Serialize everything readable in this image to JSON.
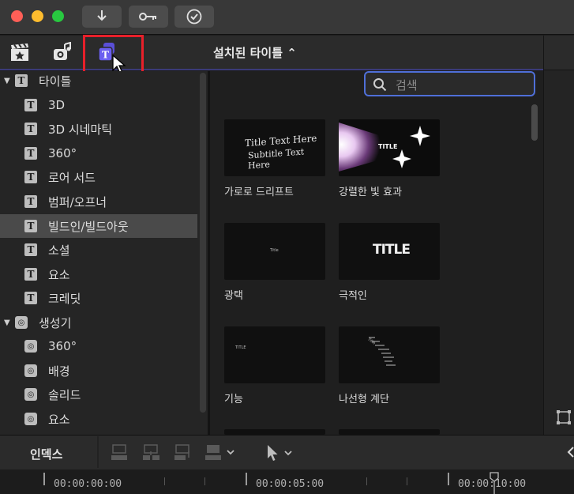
{
  "titlebar": {
    "traffic_lights": {
      "close": "#ff5f57",
      "minimize": "#febc2e",
      "maximize": "#28c840"
    },
    "buttons": [
      {
        "name": "import-button",
        "icon": "download-arrow-icon"
      },
      {
        "name": "keywords-button",
        "icon": "key-icon"
      },
      {
        "name": "background-tasks-button",
        "icon": "checkmark-circle-icon"
      }
    ]
  },
  "browser": {
    "tabs": [
      {
        "name": "libraries-tab",
        "icon": "clapperboard-star-icon"
      },
      {
        "name": "photos-audio-tab",
        "icon": "music-camera-icon"
      },
      {
        "name": "titles-generators-tab",
        "icon": "titles-generators-icon",
        "active": true
      }
    ],
    "popup_title": "설치된 타이틀 ⌃"
  },
  "sidebar": {
    "items": [
      {
        "label": "타이틀",
        "kind": "category",
        "icon": "title-T-icon"
      },
      {
        "label": "3D",
        "kind": "item",
        "icon": "title-T-icon"
      },
      {
        "label": "3D 시네마틱",
        "kind": "item",
        "icon": "title-T-icon"
      },
      {
        "label": "360°",
        "kind": "item",
        "icon": "title-T-icon"
      },
      {
        "label": "로어 서드",
        "kind": "item",
        "icon": "title-T-icon"
      },
      {
        "label": "범퍼/오프너",
        "kind": "item",
        "icon": "title-T-icon"
      },
      {
        "label": "빌드인/빌드아웃",
        "kind": "item",
        "icon": "title-T-icon",
        "selected": true
      },
      {
        "label": "소셜",
        "kind": "item",
        "icon": "title-T-icon"
      },
      {
        "label": "요소",
        "kind": "item",
        "icon": "title-T-icon"
      },
      {
        "label": "크레딧",
        "kind": "item",
        "icon": "title-T-icon"
      },
      {
        "label": "생성기",
        "kind": "category",
        "icon": "generator-icon"
      },
      {
        "label": "360°",
        "kind": "item",
        "icon": "generator-icon"
      },
      {
        "label": "배경",
        "kind": "item",
        "icon": "generator-icon"
      },
      {
        "label": "솔리드",
        "kind": "item",
        "icon": "generator-icon"
      },
      {
        "label": "요소",
        "kind": "item",
        "icon": "generator-icon"
      }
    ]
  },
  "search": {
    "placeholder": "검색"
  },
  "thumbnails": [
    {
      "caption": "가로로 드리프트",
      "preview_text_1": "Title Text Here",
      "preview_text_2": "Subtitle Text Here"
    },
    {
      "caption": "강렬한 빛 효과",
      "preview_text_1": "TITLE"
    },
    {
      "caption": "광택",
      "preview_text_1": "Title"
    },
    {
      "caption": "극적인",
      "preview_text_1": "TITLE"
    },
    {
      "caption": "기능",
      "preview_text_1": "TITLE"
    },
    {
      "caption": "나선형 계단",
      "preview_text_1": "Title"
    }
  ],
  "bottom": {
    "index_label": "인덱스",
    "timecodes": [
      "00:00:00:00",
      "00:00:05:00",
      "00:00:10:00"
    ]
  },
  "colors": {
    "accent": "#4f6fd8",
    "highlight_box": "#e8202a",
    "selection": "#4a4a4a"
  }
}
